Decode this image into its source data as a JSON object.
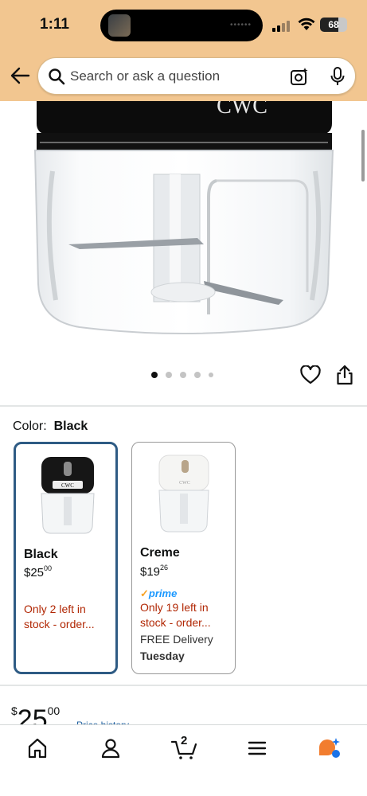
{
  "status_bar": {
    "time": "1:11",
    "battery": "68"
  },
  "search": {
    "placeholder": "Search or ask a question"
  },
  "product_image": {
    "brand_text": "CWC",
    "carousel_dots": 5,
    "active_dot": 0
  },
  "color": {
    "label": "Color:",
    "selected": "Black"
  },
  "swatches": [
    {
      "name": "Black",
      "price_whole": "25",
      "price_cents": "00",
      "stock_line1": "Only 2 left in",
      "stock_line2": "stock - order...",
      "selected": true
    },
    {
      "name": "Creme",
      "price_whole": "19",
      "price_cents": "26",
      "prime": "prime",
      "stock_line1": "Only 19 left in",
      "stock_line2": "stock - order...",
      "delivery": "FREE Delivery",
      "delivery_day": "Tuesday",
      "selected": false
    }
  ],
  "price": {
    "currency": "$",
    "whole": "25",
    "cents": "00",
    "history_link": "Price history"
  },
  "bottom_nav": {
    "cart_count": "2",
    "items": [
      "home-icon",
      "account-icon",
      "cart-icon",
      "menu-icon",
      "rufus-icon"
    ]
  },
  "colors": {
    "header": "#f2c690",
    "selected_border": "#2e5b84",
    "stock_red": "#b12704",
    "prime_blue": "#1a98ff",
    "link": "#2162a1"
  }
}
